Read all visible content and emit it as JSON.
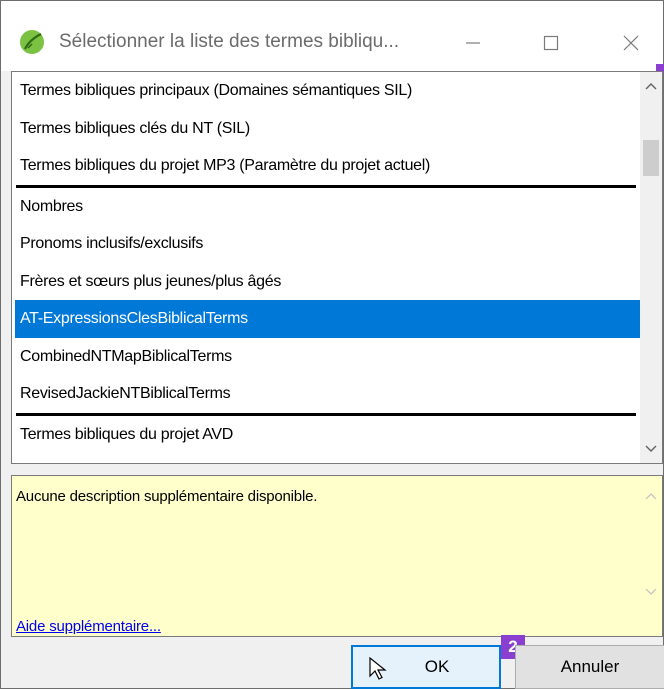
{
  "window": {
    "title": "Sélectionner la liste des termes bibliqu...",
    "min_icon": "minimize-icon",
    "max_icon": "maximize-icon",
    "close_icon": "close-icon"
  },
  "list": {
    "items": [
      {
        "label": "Termes bibliques principaux (Domaines sémantiques SIL)"
      },
      {
        "label": "Termes bibliques clés du NT (SIL)"
      },
      {
        "label": "Termes bibliques du projet MP3 (Paramètre du projet actuel)"
      },
      {
        "label": "Nombres"
      },
      {
        "label": "Pronoms inclusifs/exclusifs"
      },
      {
        "label": "Frères et sœurs plus jeunes/plus âgés"
      },
      {
        "label": "AT-ExpressionsClesBiblicalTerms"
      },
      {
        "label": "CombinedNTMapBiblicalTerms"
      },
      {
        "label": "RevisedJackieNTBiblicalTerms"
      },
      {
        "label": "Termes bibliques du projet AVD"
      }
    ],
    "selected_index": 6
  },
  "description": {
    "text": "Aucune description supplémentaire disponible.",
    "help_link": "Aide supplémentaire..."
  },
  "buttons": {
    "ok": "OK",
    "cancel": "Annuler",
    "badge": "2"
  },
  "colors": {
    "selection": "#0078d7",
    "description_bg": "#ffffcc",
    "badge": "#8a3fd1",
    "link": "#0000ee"
  }
}
